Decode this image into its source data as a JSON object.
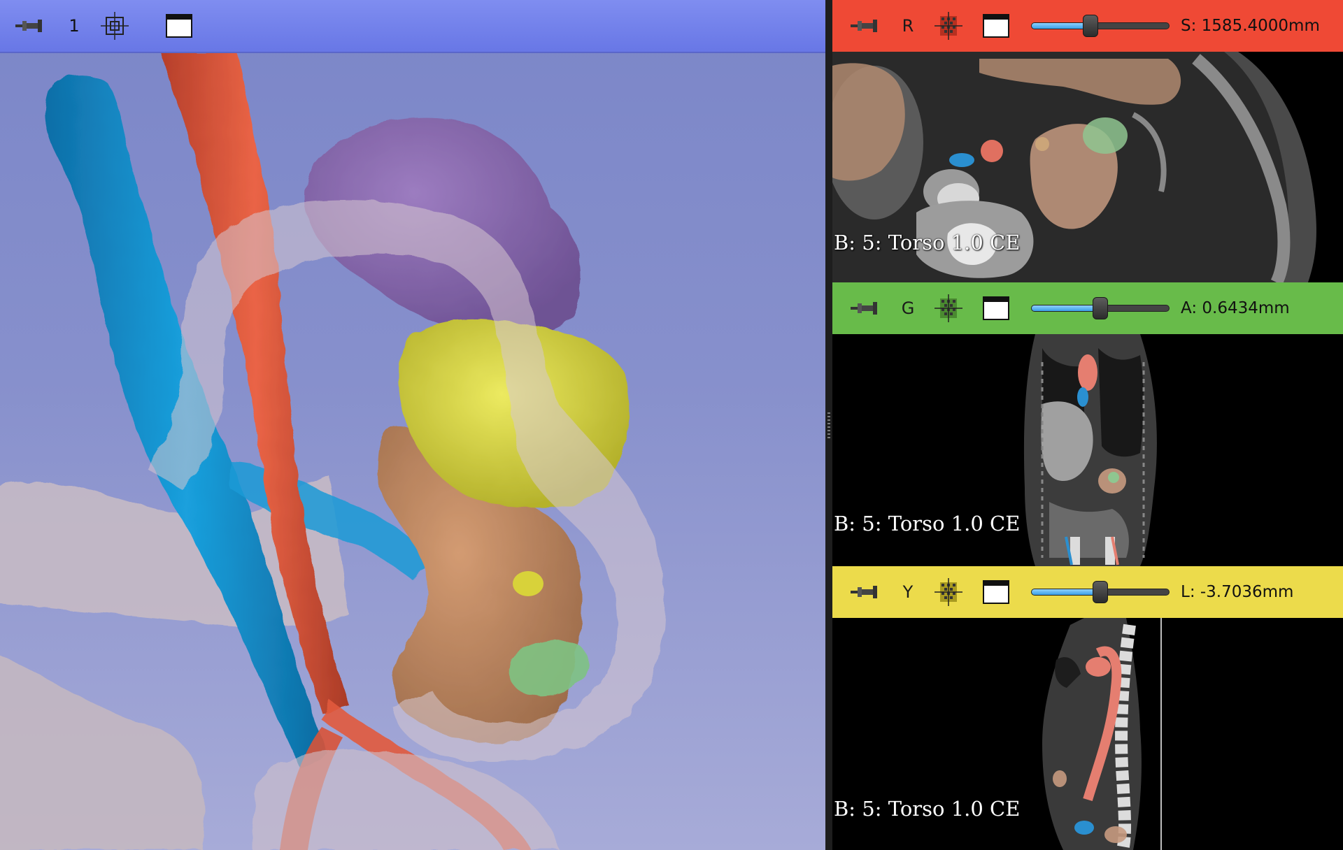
{
  "view3d": {
    "toolbar": {
      "pin_icon": "pin-icon",
      "view_number": "1",
      "center_icon": "center-view-icon",
      "layout_icon": "maximize-view-icon"
    },
    "colors": {
      "background_top": "#7b86c8",
      "background_bottom": "#a7abd8",
      "vein": "#1793d0",
      "artery": "#e25a3e",
      "spleen": "#8a6bb0",
      "kidney": "#c08963",
      "tumor": "#d9d63e",
      "cyst": "#7bbf7f",
      "bowel": "#c7b8c0"
    }
  },
  "slice_red": {
    "letter": "R",
    "offset_text": "S: 1585.4000mm",
    "slider_fraction": 0.42,
    "background_label": "B: 5: Torso 1.0 CE",
    "bar_color": "#ef4935"
  },
  "slice_green": {
    "letter": "G",
    "offset_text": "A: 0.6434mm",
    "slider_fraction": 0.5,
    "background_label": "B: 5: Torso 1.0 CE",
    "bar_color": "#68bb4a"
  },
  "slice_yellow": {
    "letter": "Y",
    "offset_text": "L: -3.7036mm",
    "slider_fraction": 0.5,
    "background_label": "B: 5: Torso 1.0 CE",
    "bar_color": "#ecdb4b"
  }
}
